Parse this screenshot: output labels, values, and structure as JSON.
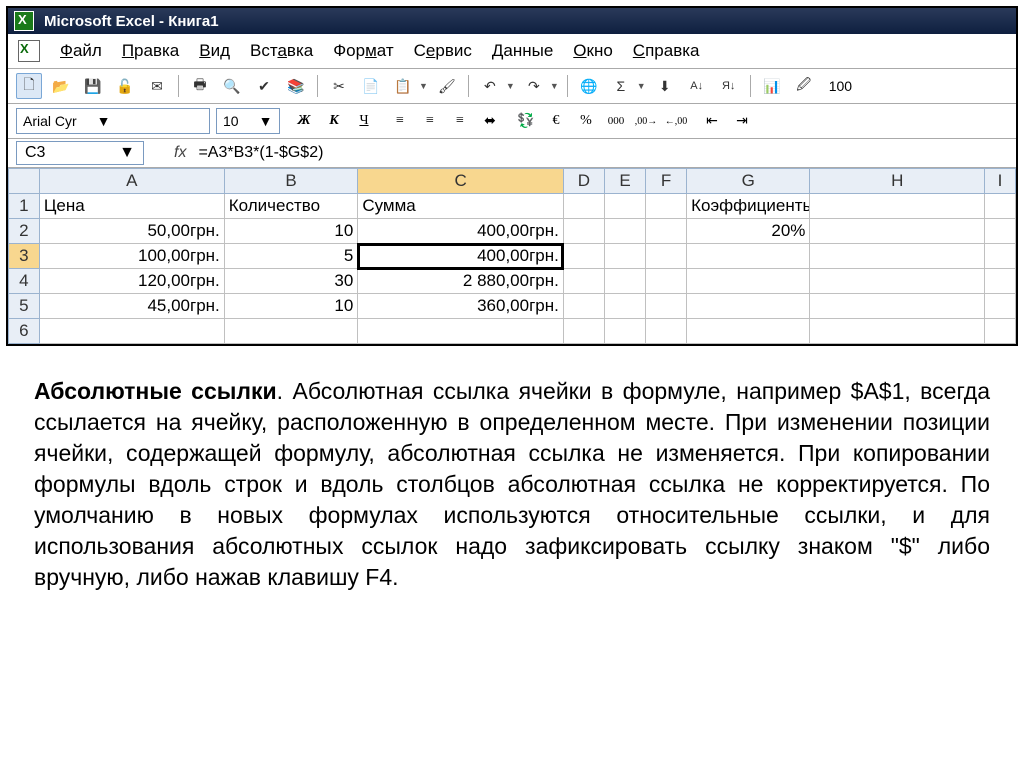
{
  "window": {
    "title": "Microsoft Excel - Книга1"
  },
  "menu": {
    "items": [
      {
        "pre": "",
        "u": "Ф",
        "post": "айл"
      },
      {
        "pre": "",
        "u": "П",
        "post": "равка"
      },
      {
        "pre": "",
        "u": "В",
        "post": "ид"
      },
      {
        "pre": "Вст",
        "u": "а",
        "post": "вка"
      },
      {
        "pre": "Фор",
        "u": "м",
        "post": "ат"
      },
      {
        "pre": "С",
        "u": "е",
        "post": "рвис"
      },
      {
        "pre": "",
        "u": "Д",
        "post": "анные"
      },
      {
        "pre": "",
        "u": "О",
        "post": "кно"
      },
      {
        "pre": "",
        "u": "С",
        "post": "правка"
      }
    ]
  },
  "toolbar1": {
    "icons": [
      "new",
      "open",
      "save",
      "perm",
      "mail",
      "print",
      "preview",
      "spell",
      "research",
      "cut",
      "copy",
      "paste",
      "format-painter",
      "undo",
      "redo",
      "hyperlink",
      "autosum",
      "sort-asc",
      "sort-desc",
      "chart",
      "drawing"
    ],
    "zoom": "100"
  },
  "formatbar": {
    "font_name": "Arial Cyr",
    "font_size": "10",
    "bold": "Ж",
    "italic": "К",
    "underline": "Ч",
    "currency": "€",
    "percent": "%",
    "thousands": "000"
  },
  "formula": {
    "namebox": "C3",
    "fx": "fx",
    "value": "=A3*B3*(1-$G$2)"
  },
  "columns": [
    "A",
    "B",
    "C",
    "D",
    "E",
    "F",
    "G",
    "H",
    "I"
  ],
  "rows": {
    "r1": {
      "A": "Цена",
      "B": "Количество",
      "C": "Сумма",
      "G": "Коэффициенты дисконта"
    },
    "r2": {
      "A": "50,00грн.",
      "B": "10",
      "C": "400,00грн.",
      "G": "20%"
    },
    "r3": {
      "A": "100,00грн.",
      "B": "5",
      "C": "400,00грн."
    },
    "r4": {
      "A": "120,00грн.",
      "B": "30",
      "C": "2 880,00грн."
    },
    "r5": {
      "A": "45,00грн.",
      "B": "10",
      "C": "360,00грн."
    }
  },
  "explain": {
    "title": "Абсолютные ссылки",
    "body": ". Абсолютная ссылка ячейки в формуле, например $A$1, всегда ссылается на ячейку, расположенную в определенном месте. При изменении позиции ячейки, содержащей формулу, абсолютная ссылка не изменяется. При копировании формулы вдоль строк и вдоль столбцов абсолютная ссылка не корректируется. По умолчанию в новых формулах используются относительные ссылки, и для использования абсолютных ссылок надо зафиксировать ссылку знаком \"$\" либо вручную, либо нажав клавишу F4."
  }
}
